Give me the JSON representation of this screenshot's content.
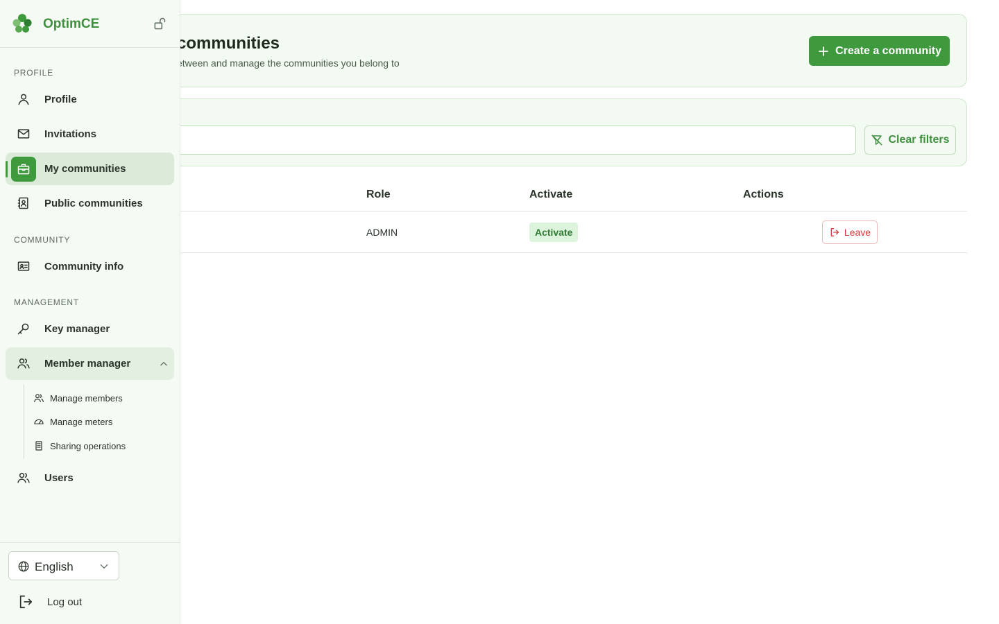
{
  "brand": {
    "name": "OptimCE"
  },
  "sidebar": {
    "sections": {
      "profile": "PROFILE",
      "community": "COMMUNITY",
      "management": "MANAGEMENT"
    },
    "items": {
      "profile": "Profile",
      "invitations": "Invitations",
      "my_communities": "My communities",
      "public_communities": "Public communities",
      "community_info": "Community info",
      "key_manager": "Key manager",
      "member_manager": "Member manager",
      "users": "Users"
    },
    "submenu": {
      "manage_members": "Manage members",
      "manage_meters": "Manage meters",
      "sharing_operations": "Sharing operations"
    },
    "language": "English",
    "logout": "Log out"
  },
  "header": {
    "title": "communities",
    "subtitle": "etween and manage the communities you belong to",
    "create_button": "Create a community"
  },
  "filters": {
    "search_value": "",
    "clear_button": "Clear filters"
  },
  "table": {
    "columns": {
      "role": "Role",
      "activate": "Activate",
      "actions": "Actions"
    },
    "rows": [
      {
        "role": "ADMIN",
        "activate_label": "Activate",
        "leave_label": "Leave"
      }
    ]
  },
  "colors": {
    "accent": "#3f9a3e",
    "accent_light": "#f3faf2",
    "danger": "#d63a3a",
    "badge_bg": "#dcf3dc"
  }
}
